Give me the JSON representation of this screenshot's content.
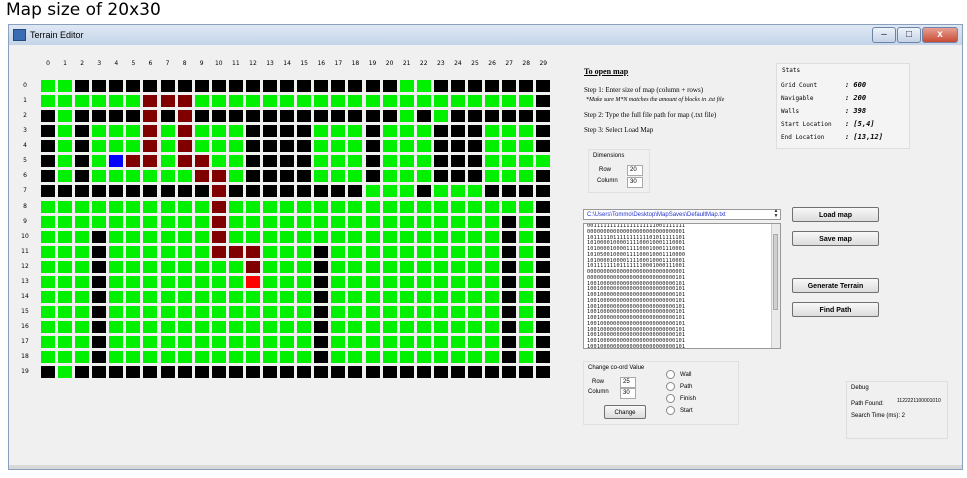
{
  "caption": "Map size of 20x30",
  "window": {
    "title": "Terrain Editor",
    "minimize": "–",
    "maximize": "□",
    "close": "x"
  },
  "grid": {
    "rows": 20,
    "cols": 30,
    "colors": {
      "wall": "#000000",
      "open": "#00f000",
      "path": "#800000",
      "start": "#0000ff",
      "end": "#ff0000"
    },
    "cells": [
      "GGKKKKKKKKKKKKKKKKKKKGGKKKKKKK",
      "GGKKKKKKKKKKKKKKKKKKKKKKKKKKKK",
      "KKKKKKKKKKKKKKKKKKKKKKKKKKKKKK",
      "KKKKKKKKKKKKKKKKKKKKKKKKKKKKKK",
      "KKKKKKKKKKKKKKKKKKKKKKKKKKKKKK",
      "KKKKKKKKKKKKKKKKKKKKKKKKKKKKKK",
      "KKKKKKKKKKKKKKKKKKKKKKKKKKKKKK",
      "KKKKKKKKKKKKKKKKKKKKKKKKKKKKKK",
      "KKKKKKKKKKKKKKKKKKKKKKKKKKKKKK",
      "KKKKKKKKKKKKKKKKKKKKKKKKKKKKKK",
      "KKKKKKKKKKKKKKKKKKKKKKKKKKKKKK",
      "KKKKKKKKKKKKKKKKKKKKKKKKKKKKKK",
      "KKKKKKKKKKKKKKKKKKKKKKKKKKKKKK",
      "KKKKKKKKKKKKKKKKKKKKKKKKKKKKKK",
      "KKKKKKKKKKKKKKKKKKKKKKKKKKKKKK",
      "KKKKKKKKKKKKKKKKKKKKKKKKKKKKKK",
      "KKKKKKKKKKKKKKKKKKKKKKKKKKKKKK",
      "KKKKKKKKKKKKKKKKKKKKKKKKKKKKKK",
      "KKKKKKKKKKKKKKKKKKKKKKKKKKKKKK",
      "KGKKKKKKKKKKKKKKKKKKKKKKKKKKKK"
    ]
  },
  "instructions": {
    "heading": "To open map",
    "step1": "Step 1: Enter size of map (column + rows)",
    "step1_note": "*Make sure M*N matches the amount of blocks in .txt file",
    "step2": "Step 2: Type the full file path for map (.txt file)",
    "step3": "Step 3: Select Load Map"
  },
  "stats": {
    "title": "Stats",
    "items": [
      {
        "label": "Grid Count",
        "value": ": 600"
      },
      {
        "label": "Navigable",
        "value": ": 200"
      },
      {
        "label": "Walls",
        "value": ": 398"
      },
      {
        "label": "Start Location",
        "value": ": [5,4]"
      },
      {
        "label": "End Location",
        "value": ": [13,12]"
      }
    ]
  },
  "dimensions": {
    "title": "Dimensions",
    "row_label": "Row",
    "row_value": "20",
    "column_label": "Column",
    "column_value": "30"
  },
  "file": {
    "path": "C:\\Users\\Tommo\\Desktop\\MapSaves\\DefaultMap.txt"
  },
  "map_text": [
    "001111111111111111111001111111",
    "000000000000000000000000000001",
    "101111101111111111101011111101",
    "101000010000111100010001110001",
    "101000010000111100010001110001",
    "101050010000111100010001110000",
    "101000010000111100010001110001",
    "101111111011111110001000111001",
    "000000000000000000000000000001",
    "000000000000000000000000000101",
    "100100000000000000000000000101",
    "100100000000000000000000000101",
    "100100000000000000000000000101",
    "100100000000000000000000000101",
    "100100000000000000000000000101",
    "100100000000000000000000000101",
    "100100000000000000000000000101",
    "100100000000000000000000000101",
    "100100000000000000000000000101",
    "100100000000000000000000000101",
    "100100000000000000000000000101",
    "100100000000000000000000000101"
  ],
  "buttons": {
    "load_map": "Load map",
    "save_map": "Save map",
    "generate_terrain": "Generate Terrain",
    "find_path": "Find Path",
    "change": "Change"
  },
  "change": {
    "title": "Change co-ord Value",
    "row_label": "Row",
    "row_value": "25",
    "column_label": "Column",
    "column_value": "30",
    "options": [
      "Wall",
      "Path",
      "Finish",
      "Start"
    ]
  },
  "debug": {
    "title": "Debug",
    "path_found_label": "Path Found:",
    "path_found_value": "1122221100001010",
    "search_time": "Search Time (ms): 2"
  }
}
